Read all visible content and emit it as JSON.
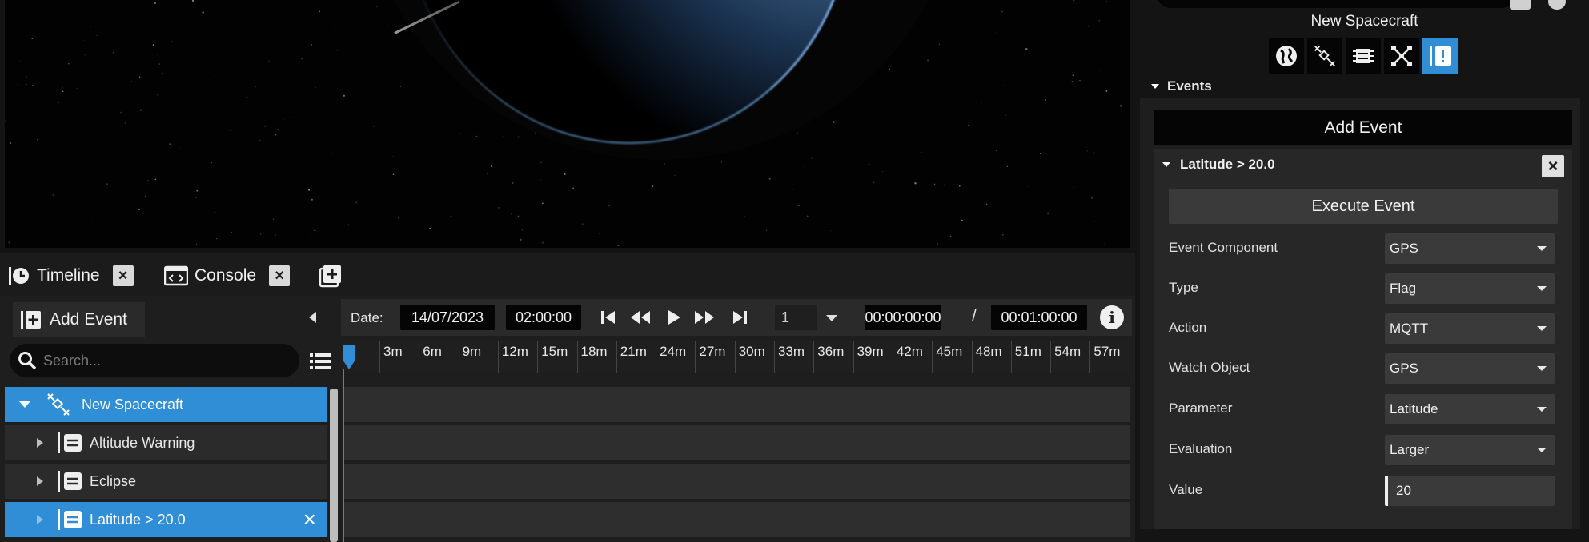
{
  "tabs": {
    "timeline": "Timeline",
    "console": "Console"
  },
  "timeline": {
    "add_event_label": "Add Event",
    "search_placeholder": "Search...",
    "date_label": "Date:",
    "date": "14/07/2023",
    "time": "02:00:00",
    "speed": "1",
    "current_time": "00:00:00:00",
    "separator": "/",
    "end_time": "00:01:00:00",
    "ruler_ticks": [
      "3m",
      "6m",
      "9m",
      "12m",
      "15m",
      "18m",
      "21m",
      "24m",
      "27m",
      "30m",
      "33m",
      "36m",
      "39m",
      "42m",
      "45m",
      "48m",
      "51m",
      "54m",
      "57m"
    ],
    "tree": [
      {
        "label": "New Spacecraft",
        "selected": true
      },
      {
        "label": "Altitude Warning",
        "selected": false
      },
      {
        "label": "Eclipse",
        "selected": false
      },
      {
        "label": "Latitude > 20.0",
        "selected": true
      }
    ]
  },
  "side": {
    "title": "New Spacecraft",
    "section": "Events",
    "add_event_label": "Add Event",
    "event": {
      "title": "Latitude > 20.0",
      "execute_label": "Execute Event",
      "props": [
        {
          "label": "Event Component",
          "value": "GPS"
        },
        {
          "label": "Type",
          "value": "Flag"
        },
        {
          "label": "Action",
          "value": "MQTT"
        },
        {
          "label": "Watch Object",
          "value": "GPS"
        },
        {
          "label": "Parameter",
          "value": "Latitude"
        },
        {
          "label": "Evaluation",
          "value": "Larger"
        },
        {
          "label": "Value",
          "value": "20"
        }
      ]
    }
  },
  "colors": {
    "accent": "#2f8ed6",
    "panel": "#1e1e1e",
    "dark": "#050505"
  }
}
